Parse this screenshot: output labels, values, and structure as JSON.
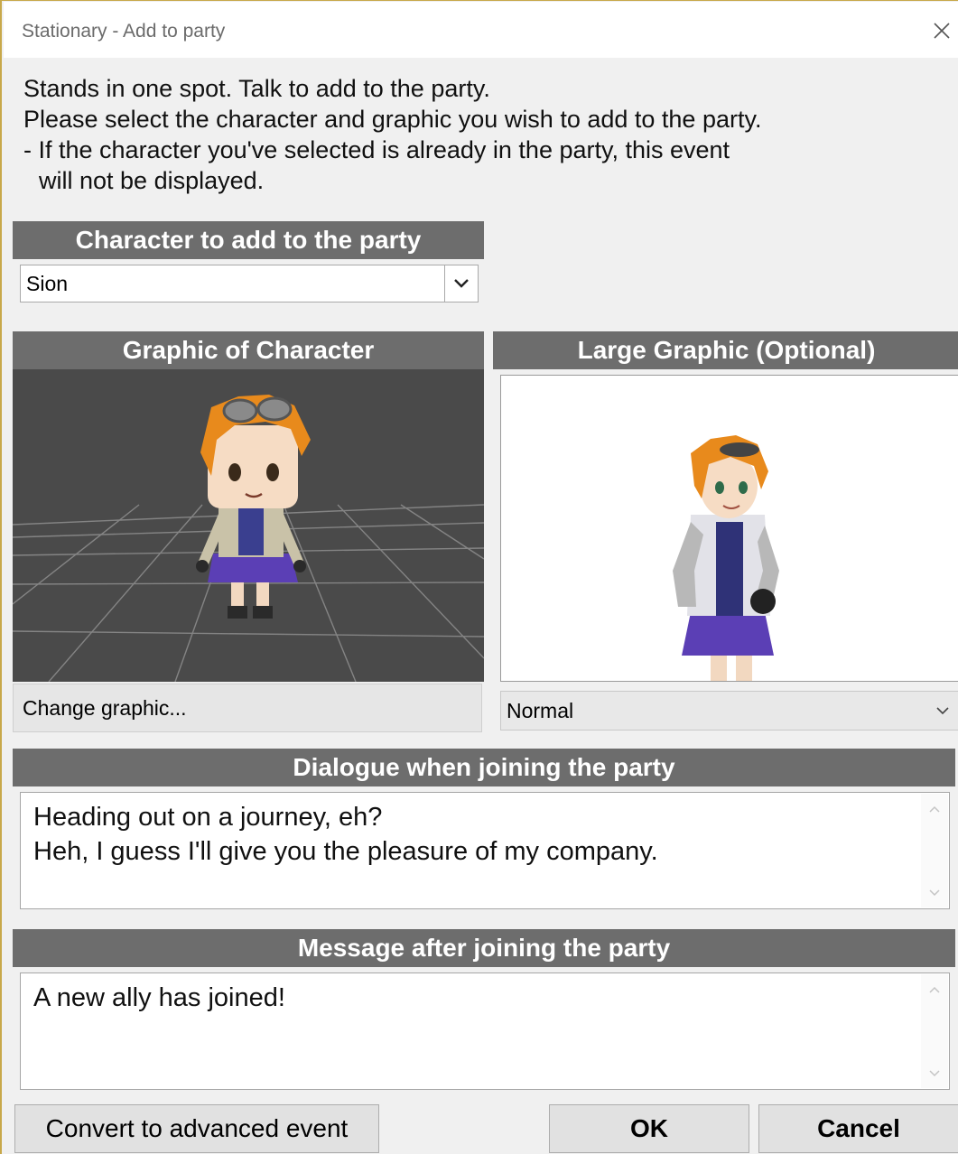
{
  "window": {
    "title": "Stationary - Add to party"
  },
  "description": {
    "lines": [
      "Stands in one spot. Talk to add to the party.",
      "Please select the character and graphic you wish to add to the party.",
      "- If the character you've selected is already in the party, this event",
      "will not be displayed."
    ]
  },
  "character": {
    "header": "Character to add to the party",
    "selected": "Sion"
  },
  "graphic": {
    "header": "Graphic of Character",
    "change_label": "Change graphic..."
  },
  "large_graphic": {
    "header": "Large Graphic (Optional)",
    "expression": "Normal"
  },
  "dialogue": {
    "header": "Dialogue when joining the party",
    "lines": [
      "Heading out on a journey, eh?",
      "Heh, I guess I'll give you the pleasure of my company."
    ]
  },
  "message": {
    "header": "Message after joining the party",
    "text": "A new ally has joined!"
  },
  "buttons": {
    "convert": "Convert to advanced event",
    "ok": "OK",
    "cancel": "Cancel"
  },
  "icons": {
    "close": "close-icon",
    "chevron": "chevron-down-icon",
    "scroll_up": "scroll-up-icon",
    "scroll_down": "scroll-down-icon"
  },
  "colors": {
    "section_header": "#6d6d6d",
    "viewport_bg": "#4a4a4a",
    "hair": "#e88a1c",
    "outfit": "#5b3fb5"
  }
}
